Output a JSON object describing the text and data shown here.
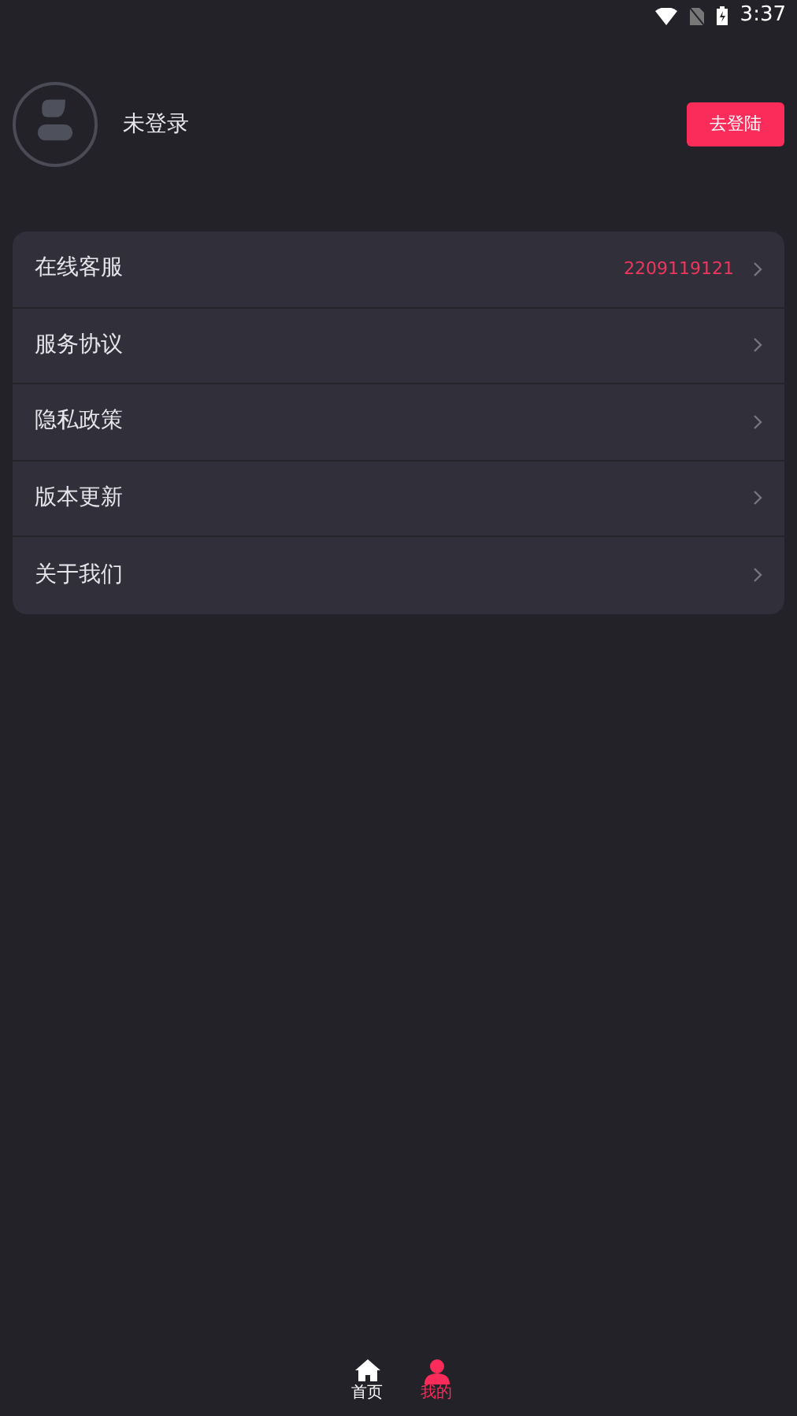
{
  "status_bar": {
    "time": "3:37"
  },
  "profile": {
    "name": "未登录",
    "login_button": "去登陆"
  },
  "menu": [
    {
      "label": "在线客服",
      "value": "2209119121"
    },
    {
      "label": "服务协议"
    },
    {
      "label": "隐私政策"
    },
    {
      "label": "版本更新"
    },
    {
      "label": "关于我们"
    }
  ],
  "tabs": [
    {
      "label": "首页",
      "kind": "home",
      "selected": false
    },
    {
      "label": "我的",
      "kind": "user",
      "selected": true
    }
  ]
}
